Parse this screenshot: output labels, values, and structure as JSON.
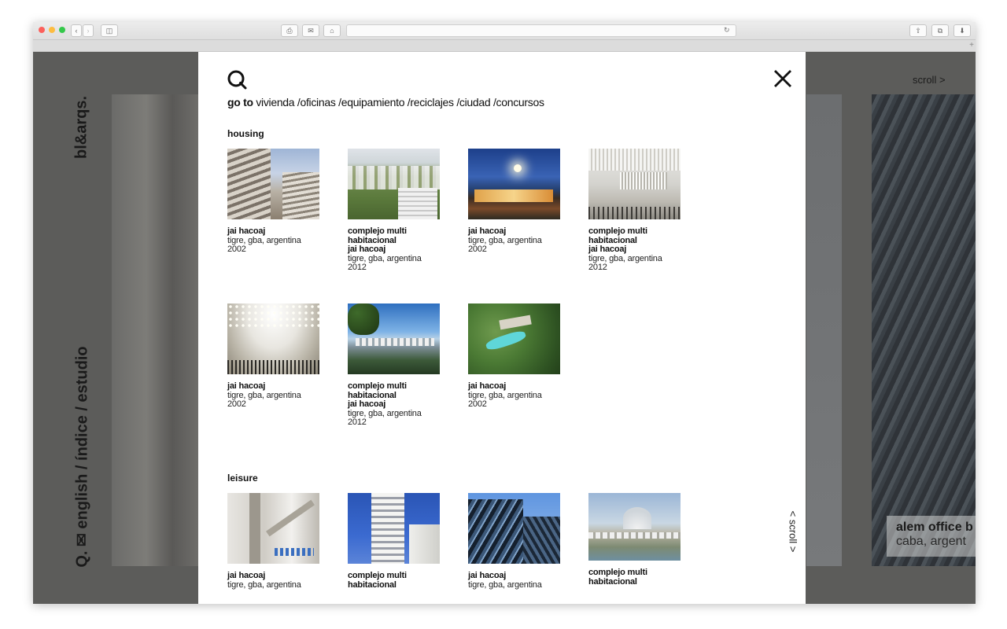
{
  "browser": {
    "url": "",
    "toolbar_icons": [
      "back-icon",
      "forward-icon",
      "sidebar-icon",
      "print-icon",
      "mail-icon",
      "home-icon",
      "reload-icon",
      "share-icon",
      "tabs-icon",
      "download-icon"
    ]
  },
  "background": {
    "brand": "bl&arqs.",
    "nav": "Q. ✉ english / índice / estudio",
    "scroll_label": "scroll >",
    "project_title": "alem office b",
    "project_location": "caba, argent"
  },
  "modal": {
    "goto_label": "go to",
    "links": [
      "vivienda /",
      "oficinas /",
      "equipamiento /",
      "reciclajes /",
      "ciudad /",
      "concursos"
    ],
    "scroll_label": "< scroll >",
    "sections": [
      {
        "title": "housing",
        "items": [
          {
            "title_lines": [
              "jai hacoaj"
            ],
            "lines": [
              "tigre, gba, argentina",
              "2002"
            ]
          },
          {
            "title_lines": [
              "complejo multi",
              "habitacional",
              "jai hacoaj"
            ],
            "lines": [
              "tigre, gba, argentina",
              "2012"
            ]
          },
          {
            "title_lines": [
              "jai hacoaj"
            ],
            "lines": [
              "tigre, gba, argentina",
              "2002"
            ]
          },
          {
            "title_lines": [
              "complejo multi",
              "habitacional",
              "jai hacoaj"
            ],
            "lines": [
              "tigre, gba, argentina",
              "2012"
            ]
          },
          {
            "title_lines": [
              "jai hacoaj"
            ],
            "lines": [
              "tigre, gba, argentina",
              "2002"
            ]
          },
          {
            "title_lines": [
              "complejo multi",
              "habitacional",
              "jai hacoaj"
            ],
            "lines": [
              "tigre, gba, argentina",
              "2012"
            ]
          },
          {
            "title_lines": [
              "jai hacoaj"
            ],
            "lines": [
              "tigre, gba, argentina",
              "2002"
            ]
          }
        ]
      },
      {
        "title": "leisure",
        "items": [
          {
            "title_lines": [
              "jai hacoaj"
            ],
            "lines": [
              "tigre, gba, argentina"
            ]
          },
          {
            "title_lines": [
              "complejo multi",
              "habitacional"
            ],
            "lines": []
          },
          {
            "title_lines": [
              "jai hacoaj"
            ],
            "lines": [
              "tigre, gba, argentina"
            ]
          },
          {
            "title_lines": [
              "complejo multi",
              "habitacional"
            ],
            "lines": []
          }
        ]
      }
    ]
  }
}
